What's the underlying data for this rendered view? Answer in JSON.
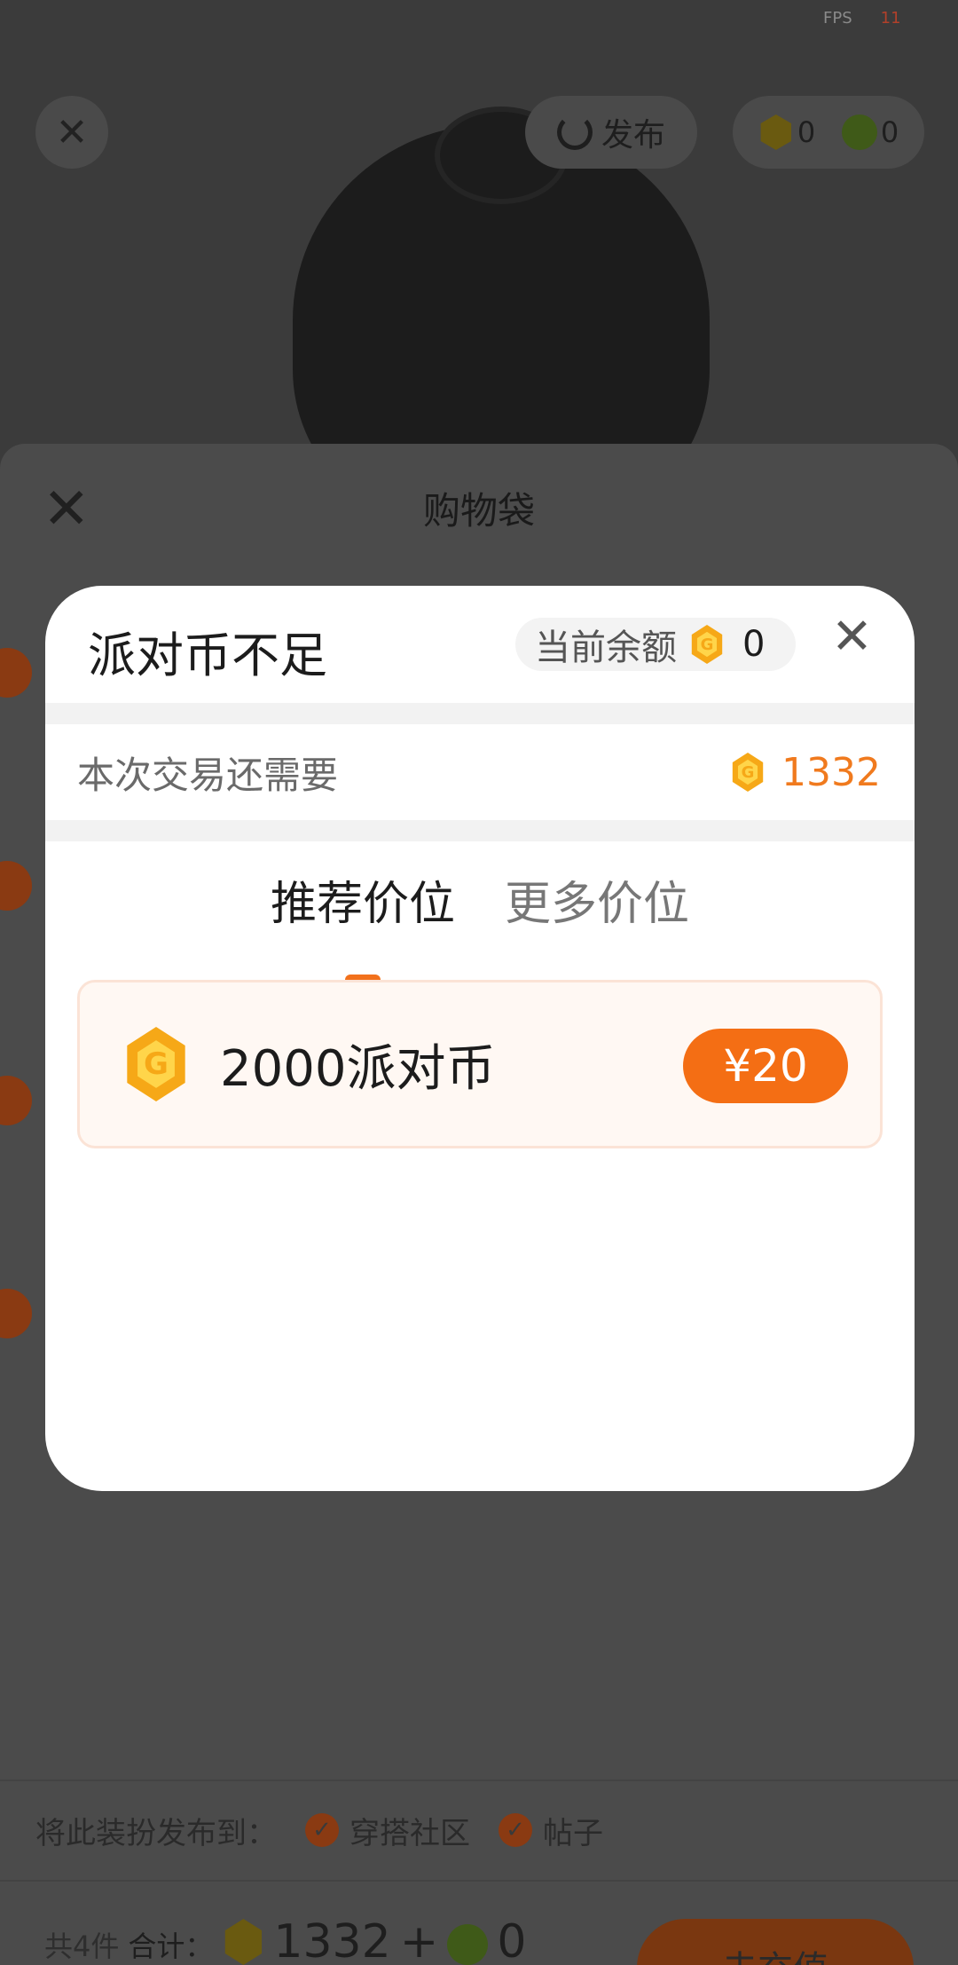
{
  "status": {
    "fps_label": "FPS",
    "fps_value": "11"
  },
  "scene": {
    "close_glyph": "✕",
    "publish_label": "发布",
    "party_coin_balance": "0",
    "green_coin_balance": "0"
  },
  "sheet": {
    "title": "购物袋",
    "close_glyph": "✕",
    "publish_to_label": "将此装扮发布到：",
    "publish_options": [
      "穿搭社区",
      "帖子"
    ],
    "item_count": "共4件",
    "total_label": "合计：",
    "total_party_coins": "1332",
    "plus": "+",
    "total_green_coins": "0",
    "recharge_label": "去充值"
  },
  "modal": {
    "title": "派对币不足",
    "balance_label": "当前余额",
    "balance_value": "0",
    "close_glyph": "✕",
    "need_label": "本次交易还需要",
    "need_value": "1332",
    "tabs": [
      {
        "label": "推荐价位",
        "active": true
      },
      {
        "label": "更多价位",
        "active": false
      }
    ],
    "offer": {
      "label": "2000派对币",
      "price": "¥20"
    }
  },
  "colors": {
    "accent": "#f46e14",
    "coin": "#f6a817",
    "need_value": "#f07a1e"
  },
  "icons": {
    "coin": "party-coin-icon",
    "close": "close-icon",
    "check": "check-icon"
  }
}
